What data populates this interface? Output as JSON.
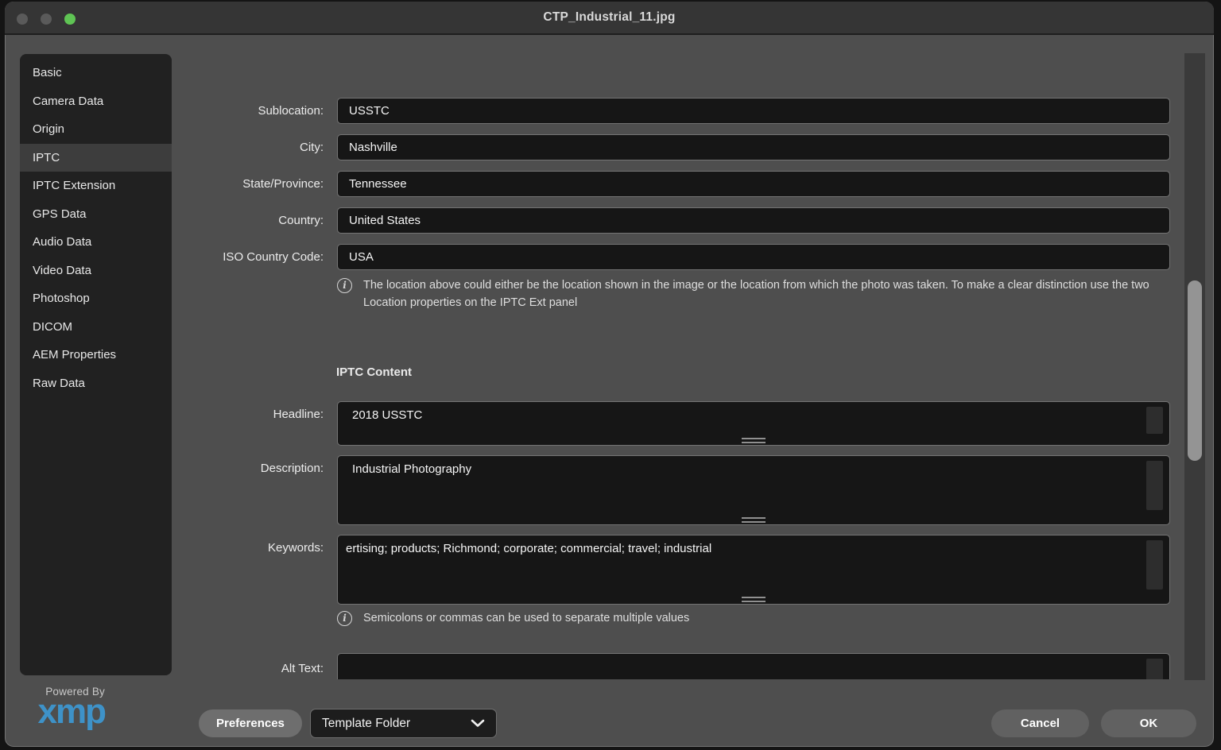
{
  "window": {
    "title": "CTP_Industrial_11.jpg"
  },
  "sidebar": {
    "selected": "IPTC",
    "items": [
      {
        "label": "Basic"
      },
      {
        "label": "Camera Data"
      },
      {
        "label": "Origin"
      },
      {
        "label": "IPTC"
      },
      {
        "label": "IPTC Extension"
      },
      {
        "label": "GPS Data"
      },
      {
        "label": "Audio Data"
      },
      {
        "label": "Video Data"
      },
      {
        "label": "Photoshop"
      },
      {
        "label": "DICOM"
      },
      {
        "label": "AEM Properties"
      },
      {
        "label": "Raw Data"
      }
    ]
  },
  "form": {
    "fields": [
      {
        "label": "Sublocation:",
        "value": "USSTC"
      },
      {
        "label": "City:",
        "value": "Nashville"
      },
      {
        "label": "State/Province:",
        "value": "Tennessee"
      },
      {
        "label": "Country:",
        "value": "United States"
      },
      {
        "label": "ISO Country Code:",
        "value": "USA"
      }
    ],
    "location_note": "The location above could either be the location shown in the image or the location from which the photo was taken. To make a clear distinction use the two Location properties on the IPTC Ext panel",
    "section_header": "IPTC Content",
    "headline": {
      "label": "Headline:",
      "value": "2018 USSTC"
    },
    "description": {
      "label": "Description:",
      "value": "Industrial Photography"
    },
    "keywords": {
      "label": "Keywords:",
      "value": "ertising; products; Richmond; corporate; commercial; travel; industrial"
    },
    "keywords_note": "Semicolons or commas can be used to separate multiple values",
    "alt_text": {
      "label": "Alt Text:",
      "value": ""
    }
  },
  "footer": {
    "powered_by": "Powered By",
    "logo": "xmp",
    "preferences_label": "Preferences",
    "template_dropdown": "Template Folder",
    "cancel_label": "Cancel",
    "ok_label": "OK"
  },
  "icons": {
    "info": "i",
    "chevron_down": "v-chevron",
    "traffic_lights": [
      "grey",
      "grey",
      "green"
    ]
  },
  "colors": {
    "window_bg": "#4e4e4e",
    "titlebar_bg": "#353535",
    "panel_bg": "#212121",
    "panel_selected": "#3d3d3d",
    "field_bg": "#161616",
    "field_border": "#747474",
    "accent_blue": "#3e92c8",
    "traffic_green": "#5fc454",
    "scroll_thumb": "#949494"
  }
}
